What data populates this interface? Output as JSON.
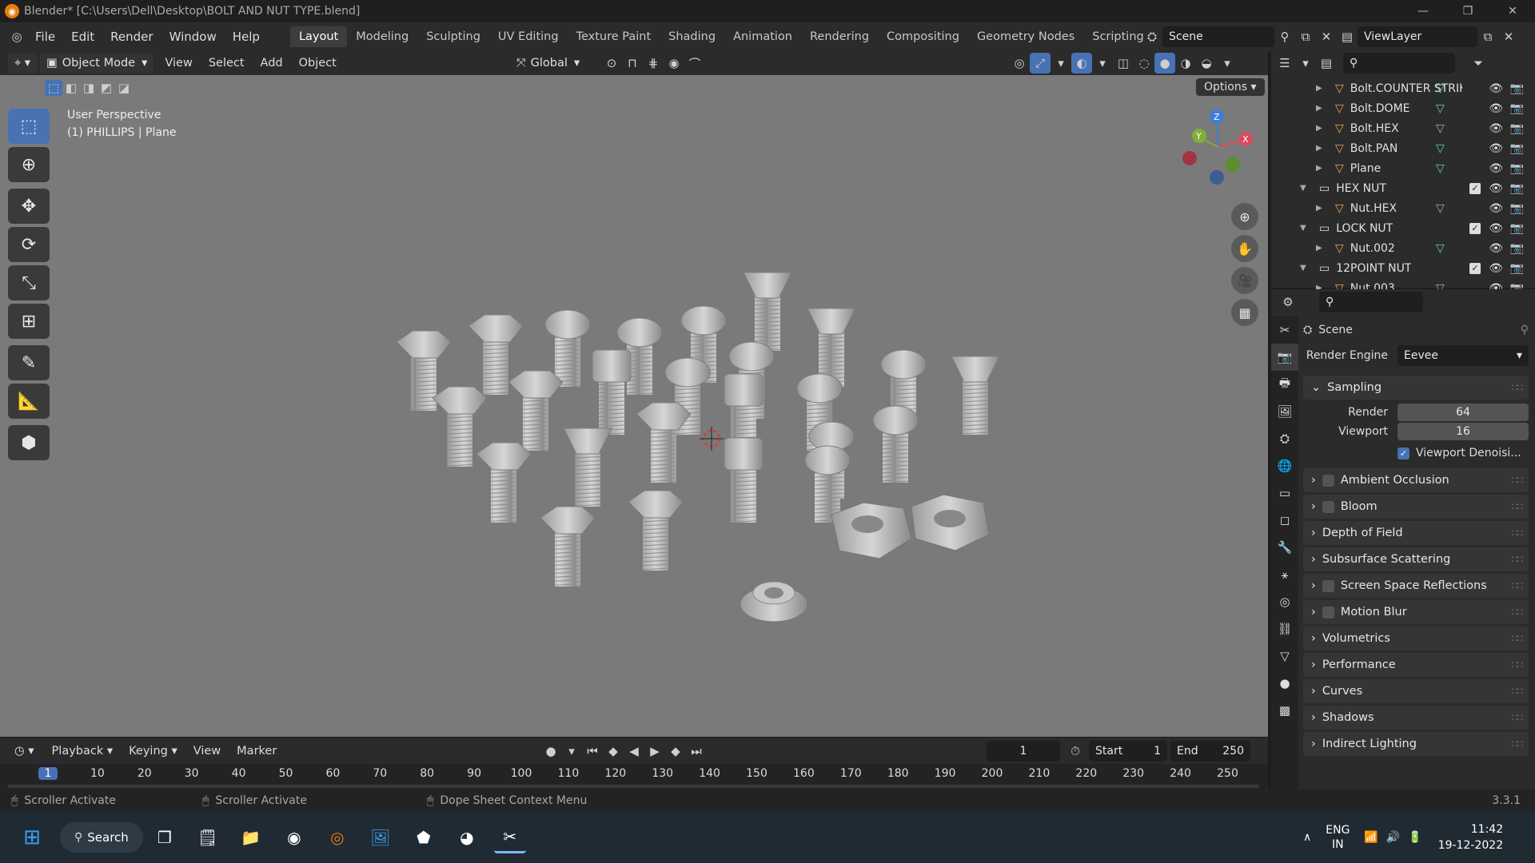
{
  "titlebar": {
    "title": "Blender* [C:\\Users\\Dell\\Desktop\\BOLT AND NUT TYPE.blend]",
    "min": "—",
    "max": "❐",
    "close": "✕"
  },
  "menu": [
    "File",
    "Edit",
    "Render",
    "Window",
    "Help"
  ],
  "workspaces": [
    "Layout",
    "Modeling",
    "Sculpting",
    "UV Editing",
    "Texture Paint",
    "Shading",
    "Animation",
    "Rendering",
    "Compositing",
    "Geometry Nodes",
    "Scripting"
  ],
  "workspace_add": "+",
  "scene": {
    "label": "Scene",
    "viewlayer": "ViewLayer"
  },
  "vpheader": {
    "mode": "Object Mode",
    "menus": [
      "View",
      "Select",
      "Add",
      "Object"
    ],
    "transform": "Global",
    "options": "Options"
  },
  "viewport": {
    "perspective": "User Perspective",
    "object": "(1) PHILLIPS | Plane",
    "axes": {
      "x": "X",
      "y": "Y",
      "z": "Z"
    }
  },
  "tool_icons": [
    "select-box-icon",
    "cursor-icon",
    "move-icon",
    "rotate-icon",
    "scale-icon",
    "transform-icon",
    "annotate-icon",
    "measure-icon",
    "add-cube-icon"
  ],
  "outliner": {
    "rows": [
      {
        "name": "Bolt.COUNTER STRIKE",
        "type": "object"
      },
      {
        "name": "Bolt.DOME",
        "type": "object"
      },
      {
        "name": "Bolt.HEX",
        "type": "object"
      },
      {
        "name": "Bolt.PAN",
        "type": "object"
      },
      {
        "name": "Plane",
        "type": "object"
      },
      {
        "name": "HEX NUT",
        "type": "collection"
      },
      {
        "name": "Nut.HEX",
        "type": "object"
      },
      {
        "name": "LOCK NUT",
        "type": "collection"
      },
      {
        "name": "Nut.002",
        "type": "object"
      },
      {
        "name": "12POINT NUT",
        "type": "collection"
      },
      {
        "name": "Nut.003",
        "type": "object"
      }
    ]
  },
  "properties": {
    "context": "Scene",
    "render_engine_label": "Render Engine",
    "render_engine": "Eevee",
    "sampling": {
      "label": "Sampling",
      "render_label": "Render",
      "render": "64",
      "viewport_label": "Viewport",
      "viewport": "16",
      "denoise": "Viewport Denoisi..."
    },
    "panels": [
      {
        "label": "Ambient Occlusion",
        "checkbox": true
      },
      {
        "label": "Bloom",
        "checkbox": true
      },
      {
        "label": "Depth of Field",
        "checkbox": false
      },
      {
        "label": "Subsurface Scattering",
        "checkbox": false
      },
      {
        "label": "Screen Space Reflections",
        "checkbox": true
      },
      {
        "label": "Motion Blur",
        "checkbox": true
      },
      {
        "label": "Volumetrics",
        "checkbox": false
      },
      {
        "label": "Performance",
        "checkbox": false
      },
      {
        "label": "Curves",
        "checkbox": false
      },
      {
        "label": "Shadows",
        "checkbox": false
      },
      {
        "label": "Indirect Lighting",
        "checkbox": false
      }
    ]
  },
  "timeline": {
    "menus": [
      "Playback",
      "Keying",
      "View",
      "Marker"
    ],
    "current_frame": "1",
    "start_label": "Start",
    "start": "1",
    "end_label": "End",
    "end": "250",
    "ticks": [
      "1",
      "10",
      "20",
      "30",
      "40",
      "50",
      "60",
      "70",
      "80",
      "90",
      "100",
      "110",
      "120",
      "130",
      "140",
      "150",
      "160",
      "170",
      "180",
      "190",
      "200",
      "210",
      "220",
      "230",
      "240",
      "250"
    ]
  },
  "status": {
    "left": "Scroller Activate",
    "mid": "Scroller Activate",
    "right": "Dope Sheet Context Menu",
    "version": "3.3.1"
  },
  "taskbar": {
    "search": "Search",
    "lang1": "ENG",
    "lang2": "IN",
    "time": "11:42",
    "date": "19-12-2022"
  },
  "colors": {
    "accent": "#4772b3",
    "orange": "#e87d0d",
    "viewport": "#7a7a7a",
    "panel": "#2b2b2b"
  }
}
